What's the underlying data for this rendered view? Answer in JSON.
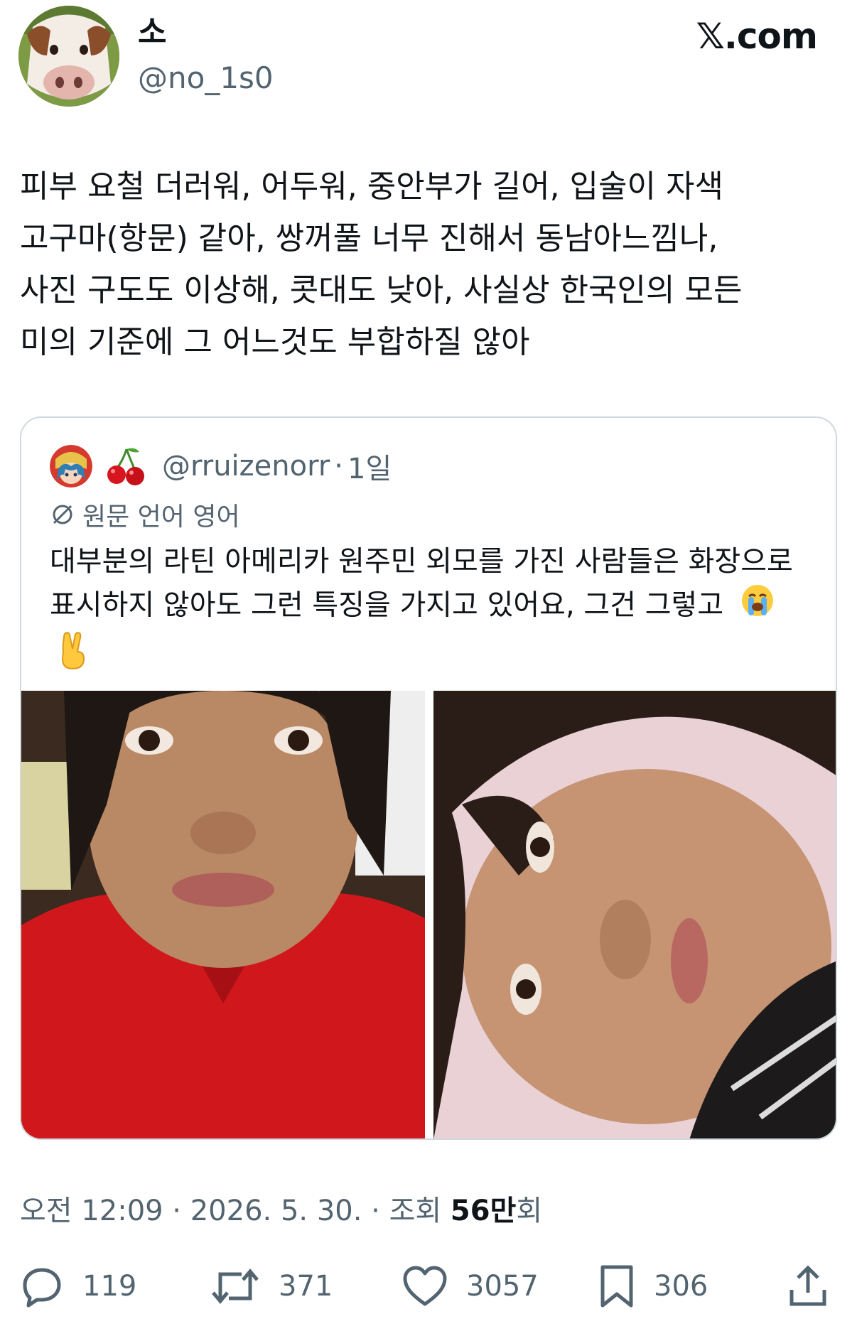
{
  "author": {
    "display_name": "소",
    "handle": "@no_1s0"
  },
  "site_label": "𝕏.com",
  "tweet": {
    "text": "피부 요철 더러워, 어두워,  중안부가 길어, 입술이 자색\n고구마(항문) 같아, 쌍꺼풀 너무 진해서 동남아느낌나,\n사진 구도도 이상해, 콧대도 낮아, 사실상 한국인의 모든\n미의 기준에 그 어느것도 부합하질 않아"
  },
  "quote": {
    "handle": "@rruizenorr",
    "separator": "·",
    "time": "1일",
    "translate_label": "원문 언어 영어",
    "text": "대부분의 라틴 아메리카 원주민 외모를 가진 사람들은 화장으로 표시하지 않아도 그런 특징을 가지고 있어요, 그건 그렇고",
    "emojis": [
      "loudly-crying-face",
      "victory-hand"
    ]
  },
  "meta": {
    "timestamp": "오전 12:09 · 2026. 5. 30. · 조회 ",
    "views": "56만",
    "views_suffix": "회"
  },
  "actions": {
    "replies": "119",
    "reposts": "371",
    "likes": "3057",
    "bookmarks": "306"
  }
}
